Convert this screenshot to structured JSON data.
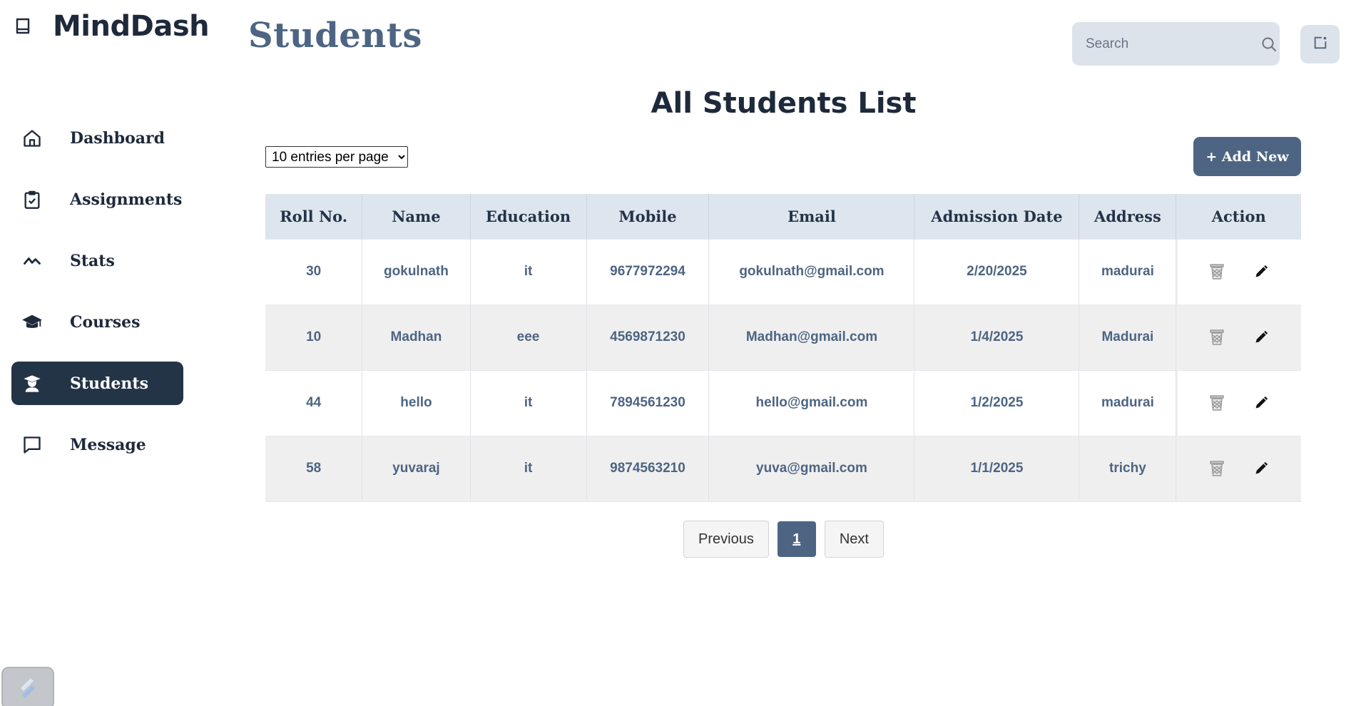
{
  "app": {
    "name": "MindDash",
    "brand_icon": "book-icon"
  },
  "sidebar": {
    "items": [
      {
        "label": "Dashboard",
        "icon": "home-icon",
        "active": false
      },
      {
        "label": "Assignments",
        "icon": "clipboard-check-icon",
        "active": false
      },
      {
        "label": "Stats",
        "icon": "trend-line-icon",
        "active": false
      },
      {
        "label": "Courses",
        "icon": "graduation-cap-icon",
        "active": false
      },
      {
        "label": "Students",
        "icon": "student-icon",
        "active": true
      },
      {
        "label": "Message",
        "icon": "message-square-icon",
        "active": false
      }
    ]
  },
  "header": {
    "title": "Students",
    "search_placeholder": "Search"
  },
  "main": {
    "list_title": "All Students List",
    "entries_options": [
      "10 entries per page"
    ],
    "entries_selected": "10 entries per page",
    "add_button": "+ Add New",
    "table": {
      "columns": [
        "Roll No.",
        "Name",
        "Education",
        "Mobile",
        "Email",
        "Admission Date",
        "Address",
        "Action"
      ],
      "rows": [
        {
          "roll": "30",
          "name": "gokulnath",
          "education": "it",
          "mobile": "9677972294",
          "email": "gokulnath@gmail.com",
          "admission_date": "2/20/2025",
          "address": "madurai"
        },
        {
          "roll": "10",
          "name": "Madhan",
          "education": "eee",
          "mobile": "4569871230",
          "email": "Madhan@gmail.com",
          "admission_date": "1/4/2025",
          "address": "Madurai"
        },
        {
          "roll": "44",
          "name": "hello",
          "education": "it",
          "mobile": "7894561230",
          "email": "hello@gmail.com",
          "admission_date": "1/2/2025",
          "address": "madurai"
        },
        {
          "roll": "58",
          "name": "yuvaraj",
          "education": "it",
          "mobile": "9874563210",
          "email": "yuva@gmail.com",
          "admission_date": "1/1/2025",
          "address": "trichy"
        }
      ]
    },
    "pagination": {
      "previous": "Previous",
      "current": "1",
      "next": "Next"
    }
  },
  "colors": {
    "accent": "#4d6583",
    "sidebar_active": "#243447",
    "header_row": "#dde5ee",
    "search_bg": "#dde3ea"
  }
}
